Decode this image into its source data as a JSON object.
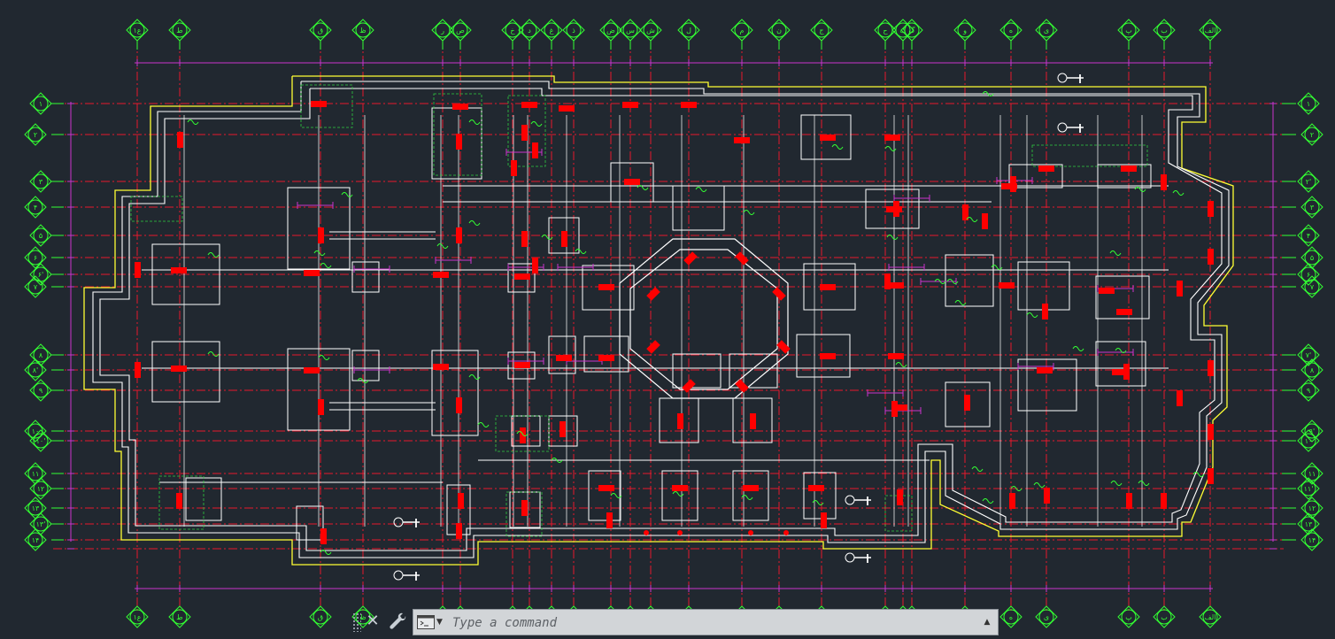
{
  "app": {
    "theme_colors": {
      "background": "#212830",
      "grid_line": "#e8192c",
      "wall": "#ffffff",
      "column": "#ff0000",
      "boundary": "#ffff33",
      "bubble": "#33ff33",
      "dimension": "#cc33cc"
    }
  },
  "command_line": {
    "placeholder": "Type a command",
    "value": "",
    "icons": {
      "close": "close-icon",
      "customize": "wrench-icon",
      "prompt": "command-prompt-icon",
      "history": "chevron-up-icon"
    }
  },
  "drawing": {
    "col_bubble_labels_top": [
      "ع۱",
      "ط",
      "ق",
      "ظ",
      "ر",
      "ص",
      "خ",
      "د",
      "غ",
      "ذ",
      "ض",
      "س",
      "ش",
      "ل",
      "م",
      "ن",
      "ج",
      "ح",
      "ک",
      "گ",
      "و",
      "ه",
      "ی",
      "پ",
      "ب",
      "الف"
    ],
    "row_bubble_labels_left": [
      "۱",
      "۲",
      "۳",
      "۴",
      "۵",
      "۶",
      "۶'",
      "۷",
      "۸",
      "۸'",
      "۹",
      "۱۰",
      "۱۰'",
      "۱۱",
      "۱۲",
      "۱۳",
      "۱۳'",
      "۱۴"
    ],
    "row_bubble_labels_right": [
      "۱",
      "۲",
      "۲'",
      "۳",
      "۴",
      "۵",
      "۶",
      "۷",
      "۷'",
      "۸",
      "۹",
      "۹'",
      "۱۰",
      "۱۱",
      "۱۱'",
      "۱۲",
      "۱۳",
      "۱۴"
    ]
  }
}
